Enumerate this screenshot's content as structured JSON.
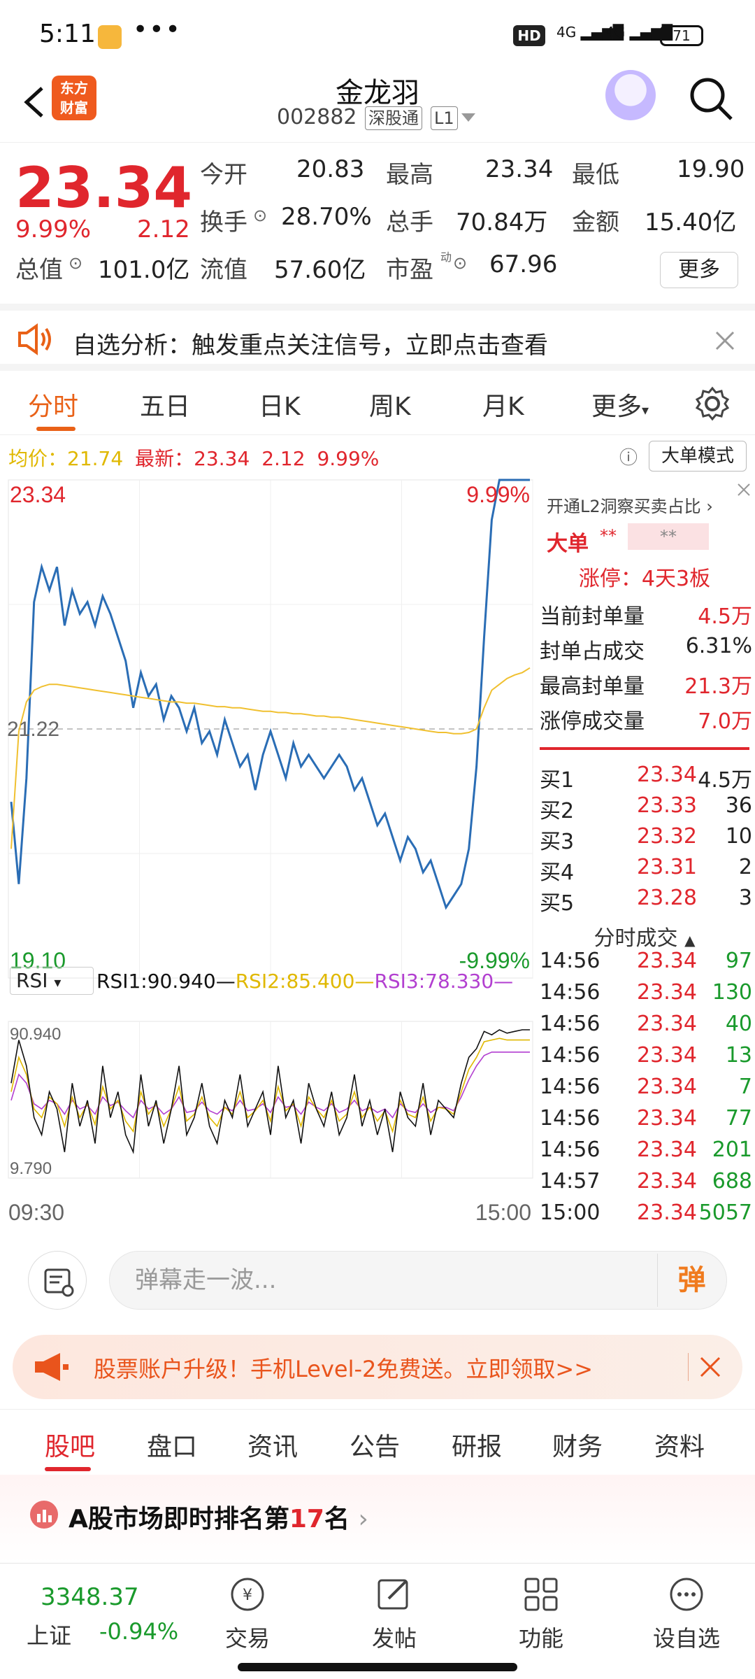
{
  "status_bar": {
    "time": "5:11",
    "dots": "•••",
    "hd": "HD",
    "sig1": "4G",
    "sig2": "4G",
    "battery": "71"
  },
  "header": {
    "logo_line1": "东方",
    "logo_line2": "财富",
    "name": "金龙羽",
    "code": "002882",
    "tag1": "深股通",
    "tag2": "L1"
  },
  "quote": {
    "price": "23.34",
    "pct": "9.99%",
    "change": "2.12",
    "rows": [
      [
        {
          "l": "今开",
          "v": "20.83",
          "c": "green"
        },
        {
          "l": "最高",
          "v": "23.34",
          "c": "red"
        },
        {
          "l": "最低",
          "v": "19.90",
          "c": "green"
        }
      ],
      [
        {
          "l": "换手",
          "v": "28.70%",
          "c": ""
        },
        {
          "l": "总手",
          "v": "70.84万",
          "c": ""
        },
        {
          "l": "金额",
          "v": "15.40亿",
          "c": ""
        }
      ],
      [
        {
          "l": "总值",
          "v": "101.0亿",
          "c": ""
        },
        {
          "l": "流值",
          "v": "57.60亿",
          "c": ""
        },
        {
          "l": "市盈",
          "v": "67.96",
          "c": ""
        }
      ]
    ],
    "pe_sup": "动",
    "more": "更多"
  },
  "notice": {
    "text": "自选分析：触发重点关注信号，立即点击查看"
  },
  "chart_tabs": [
    "分时",
    "五日",
    "日K",
    "周K",
    "月K",
    "更多"
  ],
  "info": {
    "avg_label": "均价：",
    "avg": "21.74",
    "latest_label": "最新：",
    "latest": "23.34",
    "chg": "2.12",
    "pct": "9.99%",
    "mode": "大单模式"
  },
  "chart_data": {
    "type": "line",
    "price_axis": {
      "top": "23.34",
      "mid": "21.22",
      "bottom": "19.10",
      "top_pct": "9.99%",
      "bottom_pct": "-9.99%"
    },
    "x_labels": [
      "09:30",
      "15:00"
    ],
    "ylim": [
      19.1,
      23.34
    ],
    "series": [
      {
        "color": "#2a6db5",
        "values": [
          20.6,
          19.9,
          20.8,
          22.3,
          22.6,
          22.4,
          22.6,
          22.1,
          22.4,
          22.2,
          22.3,
          22.1,
          22.35,
          22.2,
          22.0,
          21.8,
          21.4,
          21.7,
          21.5,
          21.6,
          21.3,
          21.5,
          21.4,
          21.2,
          21.4,
          21.1,
          21.2,
          21.0,
          21.3,
          21.1,
          20.9,
          21.0,
          20.7,
          21.0,
          21.2,
          21.0,
          20.8,
          21.1,
          20.9,
          21.0,
          20.9,
          20.8,
          20.9,
          21.0,
          20.9,
          20.7,
          20.8,
          20.6,
          20.4,
          20.5,
          20.3,
          20.1,
          20.3,
          20.2,
          20.0,
          20.1,
          19.9,
          19.7,
          19.8,
          19.9,
          20.2,
          20.9,
          22.0,
          23.0,
          23.34,
          23.34,
          23.34,
          23.34,
          23.34
        ]
      },
      {
        "color": "#f0c030",
        "values": [
          20.2,
          21.2,
          21.45,
          21.55,
          21.58,
          21.6,
          21.6,
          21.59,
          21.58,
          21.57,
          21.56,
          21.55,
          21.54,
          21.53,
          21.52,
          21.51,
          21.5,
          21.49,
          21.48,
          21.47,
          21.46,
          21.45,
          21.45,
          21.44,
          21.44,
          21.43,
          21.42,
          21.41,
          21.41,
          21.4,
          21.4,
          21.39,
          21.38,
          21.37,
          21.37,
          21.36,
          21.36,
          21.35,
          21.35,
          21.34,
          21.33,
          21.33,
          21.32,
          21.32,
          21.31,
          21.3,
          21.29,
          21.28,
          21.27,
          21.26,
          21.25,
          21.24,
          21.23,
          21.22,
          21.21,
          21.2,
          21.19,
          21.19,
          21.18,
          21.18,
          21.19,
          21.22,
          21.4,
          21.55,
          21.6,
          21.65,
          21.68,
          21.7,
          21.74
        ]
      }
    ],
    "rsi": {
      "selector": "RSI",
      "labels": [
        {
          "text": "RSI1:90.940—",
          "color": "#111"
        },
        {
          "text": "RSI2:85.400—",
          "color": "#e0b800"
        },
        {
          "text": "RSI3:78.330—",
          "color": "#b23fd0"
        }
      ],
      "top": "90.940",
      "bottom": "9.790",
      "ylim": [
        9.79,
        90.94
      ],
      "rsi1": [
        60,
        85,
        70,
        40,
        30,
        55,
        45,
        20,
        60,
        35,
        50,
        25,
        70,
        40,
        55,
        30,
        20,
        65,
        35,
        50,
        25,
        45,
        70,
        30,
        40,
        60,
        35,
        25,
        50,
        40,
        65,
        35,
        45,
        55,
        30,
        70,
        40,
        50,
        25,
        60,
        45,
        35,
        55,
        30,
        40,
        65,
        35,
        50,
        30,
        45,
        20,
        55,
        40,
        35,
        60,
        30,
        50,
        45,
        40,
        60,
        75,
        80,
        90,
        88,
        91,
        89,
        90,
        91,
        91
      ],
      "rsi2": [
        55,
        75,
        65,
        45,
        40,
        52,
        48,
        35,
        52,
        40,
        48,
        36,
        58,
        45,
        50,
        38,
        32,
        55,
        42,
        48,
        35,
        45,
        58,
        38,
        42,
        52,
        40,
        35,
        46,
        42,
        55,
        40,
        44,
        50,
        38,
        58,
        44,
        48,
        35,
        52,
        45,
        40,
        50,
        38,
        42,
        55,
        40,
        46,
        38,
        44,
        32,
        50,
        42,
        40,
        52,
        38,
        46,
        45,
        42,
        55,
        68,
        75,
        84,
        85,
        86,
        85,
        85,
        85,
        85
      ],
      "rsi3": [
        50,
        65,
        60,
        48,
        45,
        50,
        48,
        42,
        50,
        45,
        47,
        42,
        52,
        47,
        49,
        44,
        40,
        50,
        45,
        47,
        42,
        45,
        52,
        43,
        44,
        49,
        44,
        42,
        46,
        44,
        50,
        44,
        45,
        48,
        43,
        52,
        46,
        47,
        42,
        49,
        46,
        44,
        48,
        43,
        45,
        50,
        44,
        46,
        43,
        45,
        40,
        48,
        44,
        43,
        48,
        43,
        46,
        46,
        44,
        52,
        62,
        70,
        76,
        78,
        78,
        78,
        78,
        78,
        78
      ]
    }
  },
  "panel": {
    "l2": "开通L2洞察买卖占比",
    "big_order": "大单",
    "big_val1": "**",
    "big_val2": "**",
    "limit_up": "涨停：4天3板",
    "stats": [
      {
        "l": "当前封单量",
        "v": "4.5万"
      },
      {
        "l": "封单占成交",
        "v": "6.31%"
      },
      {
        "l": "最高封单量",
        "v": "21.3万"
      },
      {
        "l": "涨停成交量",
        "v": "7.0万"
      }
    ],
    "bids": [
      {
        "l": "买1",
        "p": "23.34",
        "v": "4.5万"
      },
      {
        "l": "买2",
        "p": "23.33",
        "v": "36"
      },
      {
        "l": "买3",
        "p": "23.32",
        "v": "10"
      },
      {
        "l": "买4",
        "p": "23.31",
        "v": "2"
      },
      {
        "l": "买5",
        "p": "23.28",
        "v": "3"
      }
    ],
    "trades_title": "分时成交",
    "trades": [
      {
        "t": "14:56",
        "p": "23.34",
        "v": "97"
      },
      {
        "t": "14:56",
        "p": "23.34",
        "v": "130"
      },
      {
        "t": "14:56",
        "p": "23.34",
        "v": "40"
      },
      {
        "t": "14:56",
        "p": "23.34",
        "v": "13"
      },
      {
        "t": "14:56",
        "p": "23.34",
        "v": "7"
      },
      {
        "t": "14:56",
        "p": "23.34",
        "v": "77"
      },
      {
        "t": "14:56",
        "p": "23.34",
        "v": "201"
      },
      {
        "t": "14:57",
        "p": "23.34",
        "v": "688"
      },
      {
        "t": "15:00",
        "p": "23.34",
        "v": "5057"
      }
    ]
  },
  "danmaku": {
    "placeholder": "弹幕走一波...",
    "send": "弹"
  },
  "banner": {
    "text": "股票账户升级！手机Level-2免费送。立即领取>>"
  },
  "bottom_tabs": [
    "股吧",
    "盘口",
    "资讯",
    "公告",
    "研报",
    "财务",
    "资料"
  ],
  "rank": {
    "prefix": "A股市场即时排名第",
    "num": "17",
    "suffix": "名"
  },
  "nav": {
    "index_value": "3348.37",
    "index_name": "上证",
    "index_chg": "-0.94%",
    "items": [
      "交易",
      "发帖",
      "功能",
      "设自选"
    ]
  },
  "colors": {
    "accent": "#e96117",
    "up": "#e0262d",
    "down": "#1a9a2c",
    "price_line": "#2a6db5",
    "avg_line": "#f0c030"
  }
}
